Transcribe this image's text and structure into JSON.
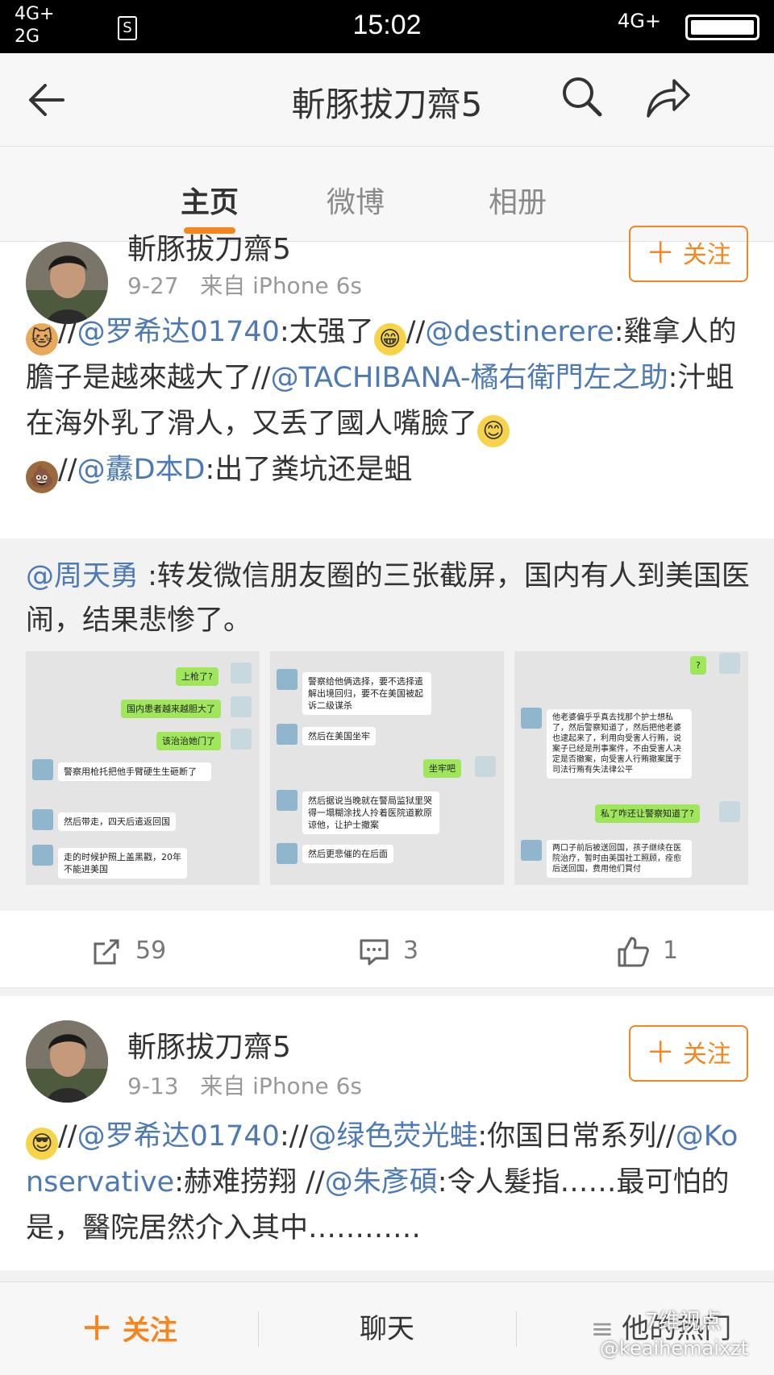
{
  "status_bar": {
    "signal_top": "4G+",
    "signal_bottom": "2G",
    "sim_label": "S",
    "time": "15:02",
    "network": "4G+"
  },
  "nav": {
    "title": "斬豚拔刀齋5",
    "back_icon": "back-arrow-icon",
    "search_icon": "search-icon",
    "share_icon": "share-icon"
  },
  "tabs": [
    {
      "label": "主页",
      "active": true
    },
    {
      "label": "微博",
      "active": false
    },
    {
      "label": "相册",
      "active": false
    }
  ],
  "post1": {
    "username": "斬豚拔刀齋5",
    "date": "9-27",
    "source": "来自 iPhone 6s",
    "follow_label": "关注",
    "text": {
      "s1": "//",
      "m1": "@罗希达01740",
      "s2": ":太强了",
      "s3": "//",
      "m2": "@destinerere",
      "s4": ":雞拿人的膽子是越來越大了//",
      "m3": "@TACHIBANA-橘右衛門左之助",
      "s5": ":汁蛆在海外乳了滑人，又丢了國人嘴臉了",
      "s6": "//",
      "m4": "@纛D本D",
      "s7": ":出了粪坑还是蛆"
    },
    "repost": {
      "mention": "@周天勇",
      "text": " :转发微信朋友圈的三张截屏，国内有人到美国医闹，结果悲惨了。"
    },
    "screenshots": [
      {
        "bubbles": [
          "上枪了?",
          "国内患者越来越胆大了",
          "该治治她门了",
          "警察用枪托把他手臂硬生生砸断了",
          "然后带走，四天后遣返回国",
          "走的时候护照上盖黑戳，20年不能进美国"
        ]
      },
      {
        "bubbles": [
          "警察给他俩选择，要不选择遣解出境回归，要不在美国被起诉二级谋杀",
          "然后在美国坐牢",
          "坐牢吧",
          "然后据说当晚就在警局监狱里哭得一塌糊涂找人拎着医院道歉原谅他，让护士撤案",
          "然后更悲催的在后面"
        ]
      },
      {
        "bubbles": [
          "?",
          "他老婆偏乎乎真去找那个护士想私了，然后警察知道了，然后把他老婆也逮起来了，利用向受害人行贿，说案子已经是刑事案件，不由受害人决定是否撤案，向受害人行贿撤案属于司法行贿有失法律公平",
          "私了咋还让警察知道了?",
          "两口子前后被送回国，孩子继续在医院治疗，暂时由美国社工照顾，痊愈后送回国，费用他们買付"
        ]
      }
    ],
    "actions": {
      "repost_count": "59",
      "comment_count": "3",
      "like_count": "1"
    }
  },
  "post2": {
    "username": "斬豚拔刀齋5",
    "date": "9-13",
    "source": "来自 iPhone 6s",
    "follow_label": "关注",
    "text": {
      "s1": "//",
      "m1": "@罗希达01740",
      "s2": "://",
      "m2": "@绿色荧光蛙",
      "s3": ":你国日常系列//",
      "m3": "@Konservative",
      "s4": ":赫难捞翔 //",
      "m4": "@朱彥碩",
      "s5": ":令人髮指……最可怕的是，醫院居然介入其中…………"
    }
  },
  "bottom_bar": {
    "follow": "关注",
    "chat": "聊天",
    "hot": "他的热门"
  },
  "watermark": {
    "line1": "7维视点",
    "line2": "@keaihemaixzt"
  },
  "colors": {
    "accent": "#f7851d",
    "link": "#4d79b4"
  }
}
